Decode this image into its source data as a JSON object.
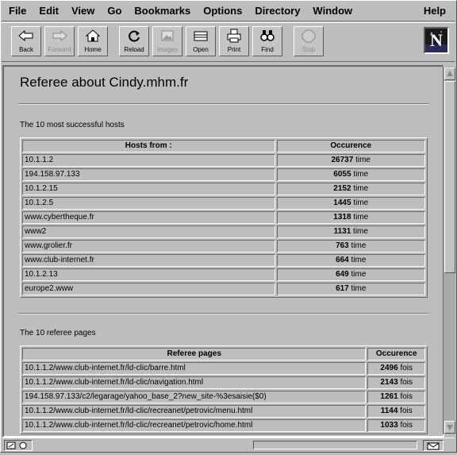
{
  "menubar": {
    "items": [
      "File",
      "Edit",
      "View",
      "Go",
      "Bookmarks",
      "Options",
      "Directory",
      "Window"
    ],
    "help": "Help"
  },
  "toolbar": {
    "back": "Back",
    "forward": "Forward",
    "home": "Home",
    "reload": "Reload",
    "images": "Images",
    "open": "Open",
    "print": "Print",
    "find": "Find",
    "stop": "Stop",
    "logo_letter": "N"
  },
  "page": {
    "title": "Referee about Cindy.mhm.fr",
    "hosts_section": {
      "heading": "The 10 most successful hosts",
      "col1": "Hosts from :",
      "col2": "Occurence",
      "unit": "time",
      "rows": [
        {
          "host": "10.1.1.2",
          "count": "26737"
        },
        {
          "host": "194.158.97.133",
          "count": "6055"
        },
        {
          "host": "10.1.2.15",
          "count": "2152"
        },
        {
          "host": "10.1.2.5",
          "count": "1445"
        },
        {
          "host": "www.cybertheque.fr",
          "count": "1318"
        },
        {
          "host": "www2",
          "count": "1131"
        },
        {
          "host": "www.grolier.fr",
          "count": "763"
        },
        {
          "host": "www.club-internet.fr",
          "count": "664"
        },
        {
          "host": "10.1.2.13",
          "count": "649"
        },
        {
          "host": "europe2.www",
          "count": "617"
        }
      ]
    },
    "referee_section": {
      "heading": "The 10 referee pages",
      "col1": "Referee pages",
      "col2": "Occurence",
      "unit": "fois",
      "rows": [
        {
          "page": "10.1.1.2/www.club-internet.fr/ld-clic/barre.html",
          "count": "2496"
        },
        {
          "page": "10.1.1.2/www.club-internet.fr/ld-clic/navigation.html",
          "count": "2143"
        },
        {
          "page": "194.158.97.133/c2/legarage/yahoo_base_2?new_site-%3esaisie($0)",
          "count": "1261"
        },
        {
          "page": "10.1.1.2/www.club-internet.fr/ld-clic/recreanet/petrovic/menu.html",
          "count": "1144"
        },
        {
          "page": "10.1.1.2/www.club-internet.fr/ld-clic/recreanet/petrovic/home.html",
          "count": "1033"
        }
      ]
    }
  },
  "colors": {
    "chrome": "#bdbdbd",
    "logo_bg": "#1a1a1a"
  }
}
